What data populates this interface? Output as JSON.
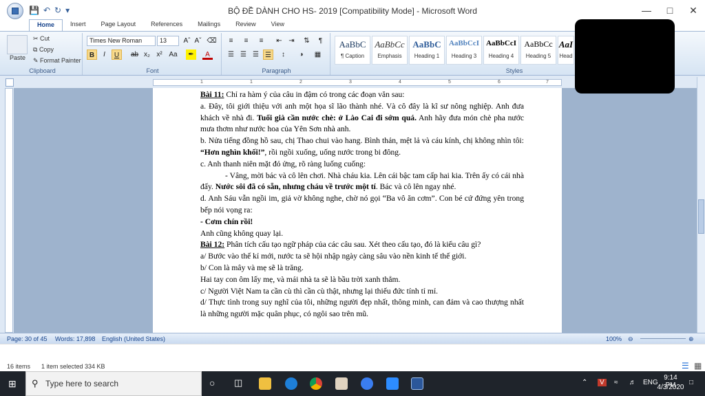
{
  "window": {
    "title": "BỘ ĐỀ DÀNH CHO HS- 2019 [Compatibility Mode] - Microsoft Word",
    "qat": [
      "save-icon",
      "undo-icon",
      "redo-icon"
    ]
  },
  "tabs": [
    "Home",
    "Insert",
    "Page Layout",
    "References",
    "Mailings",
    "Review",
    "View"
  ],
  "ribbon": {
    "clipboard": {
      "label": "Clipboard",
      "paste": "Paste",
      "cut": "Cut",
      "copy": "Copy",
      "format_painter": "Format Painter"
    },
    "font": {
      "label": "Font",
      "family": "Times New Roman",
      "size": "13"
    },
    "paragraph": {
      "label": "Paragraph"
    },
    "styles": {
      "label": "Styles",
      "items": [
        {
          "preview": "AaBbC",
          "name": "¶ Caption"
        },
        {
          "preview": "AaBbCc",
          "name": "Emphasis"
        },
        {
          "preview": "AaBbC",
          "name": "Heading 1"
        },
        {
          "preview": "AaBbCcI",
          "name": "Heading 3"
        },
        {
          "preview": "AaBbCcI",
          "name": "Heading 4"
        },
        {
          "preview": "AaBbCc",
          "name": "Heading 5"
        },
        {
          "preview": "AaI",
          "name": "Head"
        }
      ]
    }
  },
  "ruler": {
    "numbers": [
      "1",
      "1",
      "2",
      "3",
      "4",
      "5",
      "6",
      "7"
    ]
  },
  "document": {
    "l1_label": "Bài 11:",
    "l1_rest": " Chỉ ra hàm ý của câu in đậm có trong các đoạn văn sau:",
    "pa_1": "a. Đây, tôi giới thiệu với anh một họa sĩ lão thành nhé. Và cô đây là kĩ sư nông nghiệp. Anh đưa khách về nhà đi. ",
    "pa_bold": "Tuổi già cần nước chè: ở Lào Cai đi sớm quá.",
    "pa_2": " Anh hãy đưa món chè pha nước mưa thơm như nước hoa của Yên Sơn nhà anh.",
    "pb_1": "b. Nửa tiếng đồng hồ sau, chị Thao chui vào hang. Bình thản, mệt lả và cáu kính, chị không nhìn tôi: ",
    "pb_bold": "“Hơn nghìn khối!”",
    "pb_2": ", rồi ngồi xuống, uống nước trong bi đông.",
    "pc": "c. Anh thanh niên mặt đỏ ửng, rõ ràng luống cuống:",
    "pc2_1": "- Vâng, mời bác và cô lên chơi. Nhà cháu kia. Lên cái bậc tam cấp hai kia. Trên ấy có cái nhà đấy. ",
    "pc2_bold": "Nước sôi đã có sẵn, nhưng cháu về trước một tí",
    "pc2_2": ". Bác và cô lên ngay nhé.",
    "pd": "d. Anh Sáu vẫn ngồi im, giả vờ không nghe, chờ nó gọi “Ba vô ăn cơm”. Con bé cứ đứng yên trong bếp nói vọng ra:",
    "pd2": "- Cơm chín rồi!",
    "pd3": " Anh cũng không quay lại.",
    "l12_label": "Bài 12:",
    "l12_rest": "  Phân tích cấu tạo ngữ pháp của các câu sau. Xét theo cấu tạo, đó là kiểu câu gì?",
    "q_a": "a/  Bước vào thế kỉ mới, nước ta sẽ hội nhập ngày càng sâu vào nền kinh tế thế giới.",
    "q_b": "b/  Con là mây và mẹ sẽ là trăng.",
    "q_b2": "Hai tay con ôm lấy mẹ, và mái nhà ta sẽ là bầu trời xanh thẳm.",
    "q_c": "c/ Người Việt Nam ta cần cù thì cần cù thật, nhưng lại thiếu đức tính tỉ mỉ.",
    "q_d": "d/ Thực tình trong suy nghĩ của tôi, những người đẹp nhất, thông minh, can đảm và cao thượng nhất là những người mặc quân phục, có ngôi sao trên mũ."
  },
  "status": {
    "page": "Page: 30 of 45",
    "words": "Words: 17,898",
    "language": "English (United States)",
    "zoom": "100%"
  },
  "explorer": {
    "items": "16 items",
    "selected": "1 item selected  334 KB"
  },
  "taskbar": {
    "search_placeholder": "Type here to search",
    "lang": "ENG",
    "time": "9:14 PM",
    "date": "4/3/2020"
  }
}
